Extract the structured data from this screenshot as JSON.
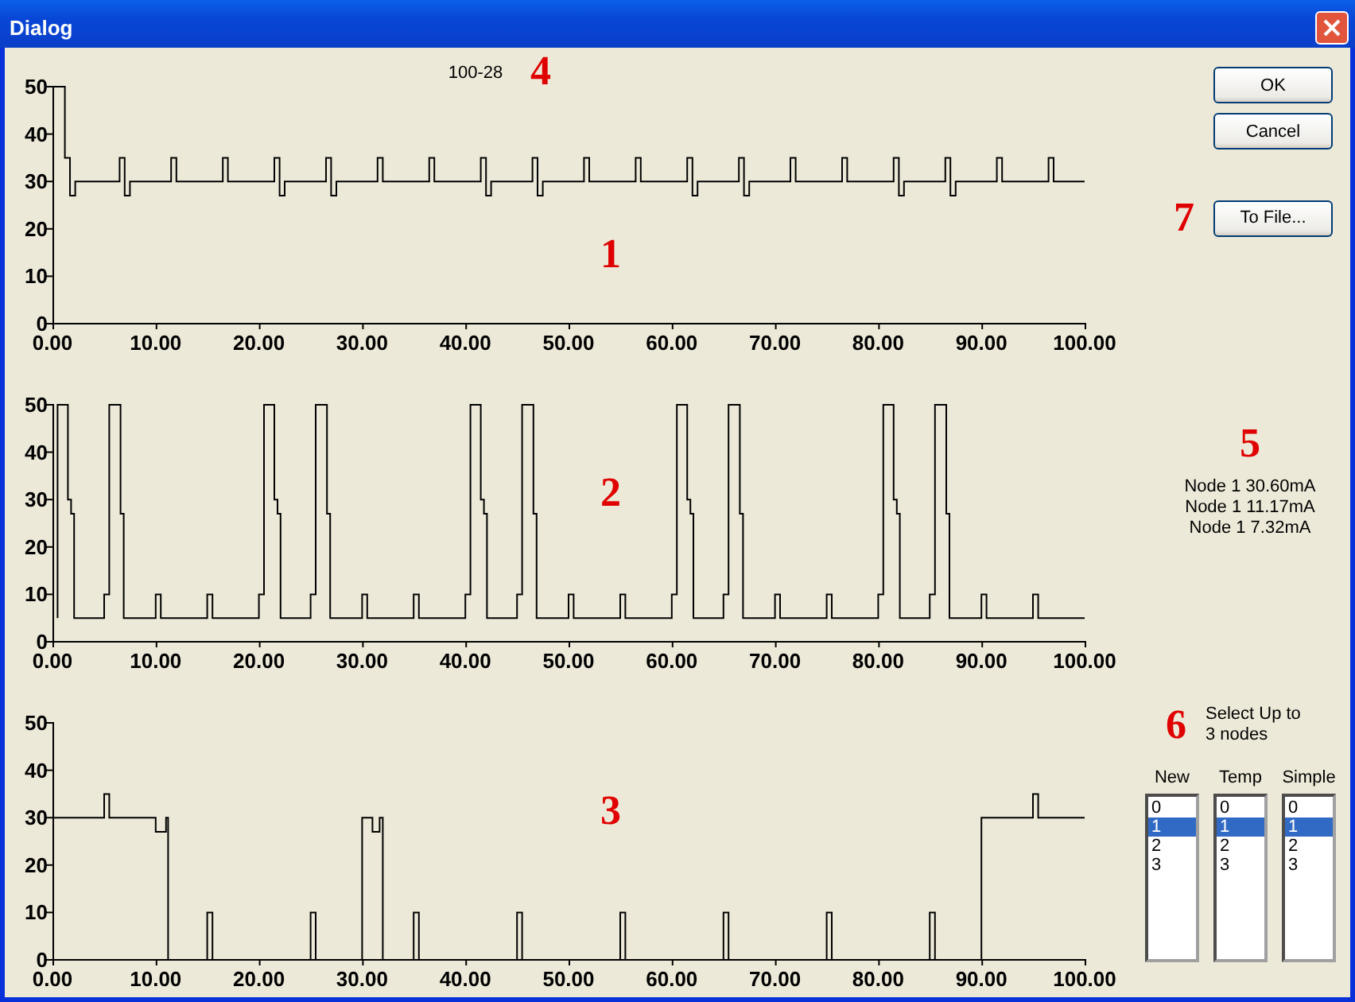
{
  "window": {
    "title": "Dialog"
  },
  "charts": [
    {
      "callout": "1",
      "title_callout": "4",
      "chart_data": {
        "type": "line",
        "title": "100-28",
        "xlim": [
          0,
          100
        ],
        "ylim": [
          0,
          50
        ],
        "xticks": [
          {
            "value": 0,
            "label": "0.00"
          },
          {
            "value": 10,
            "label": "10.00"
          },
          {
            "value": 20,
            "label": "20.00"
          },
          {
            "value": 30,
            "label": "30.00"
          },
          {
            "value": 40,
            "label": "40.00"
          },
          {
            "value": 50,
            "label": "50.00"
          },
          {
            "value": 60,
            "label": "60.00"
          },
          {
            "value": 70,
            "label": "70.00"
          },
          {
            "value": 80,
            "label": "80.00"
          },
          {
            "value": 90,
            "label": "90.00"
          },
          {
            "value": 100,
            "label": "100.00"
          }
        ],
        "yticks": [
          0,
          10,
          20,
          30,
          40,
          50
        ],
        "x": [
          0,
          1.2,
          1.2,
          1.7,
          1.7,
          2.2,
          2.2,
          6.5,
          6.5,
          7,
          7,
          7.5,
          7.5,
          11.5,
          11.5,
          12,
          12,
          16.5,
          16.5,
          17,
          17,
          21.5,
          21.5,
          22,
          22,
          22.5,
          22.5,
          26.5,
          26.5,
          27,
          27,
          27.5,
          27.5,
          31.5,
          31.5,
          32,
          32,
          36.5,
          36.5,
          37,
          37,
          41.5,
          41.5,
          42,
          42,
          42.5,
          42.5,
          46.5,
          46.5,
          47,
          47,
          47.5,
          47.5,
          51.5,
          51.5,
          52,
          52,
          56.5,
          56.5,
          57,
          57,
          61.5,
          61.5,
          62,
          62,
          62.5,
          62.5,
          66.5,
          66.5,
          67,
          67,
          67.5,
          67.5,
          71.5,
          71.5,
          72,
          72,
          76.5,
          76.5,
          77,
          77,
          81.5,
          81.5,
          82,
          82,
          82.5,
          82.5,
          86.5,
          86.5,
          87,
          87,
          87.5,
          87.5,
          91.5,
          91.5,
          92,
          92,
          96.5,
          96.5,
          97,
          97,
          100
        ],
        "series": [
          {
            "color": "#000000",
            "values": [
              50,
              50,
              35,
              35,
              27,
              27,
              30,
              30,
              35,
              35,
              27,
              27,
              30,
              30,
              35,
              35,
              30,
              30,
              35,
              35,
              30,
              30,
              35,
              35,
              27,
              27,
              30,
              30,
              35,
              35,
              27,
              27,
              30,
              30,
              35,
              35,
              30,
              30,
              35,
              35,
              30,
              30,
              35,
              35,
              27,
              27,
              30,
              30,
              35,
              35,
              27,
              27,
              30,
              30,
              35,
              35,
              30,
              30,
              35,
              35,
              30,
              30,
              35,
              35,
              27,
              27,
              30,
              30,
              35,
              35,
              27,
              27,
              30,
              30,
              35,
              35,
              30,
              30,
              35,
              35,
              30,
              30,
              35,
              35,
              27,
              27,
              30,
              30,
              35,
              35,
              27,
              27,
              30,
              30,
              35,
              35,
              30,
              30,
              35,
              35,
              30,
              30
            ]
          }
        ]
      }
    },
    {
      "callout": "2",
      "chart_data": {
        "type": "line",
        "xlim": [
          0,
          100
        ],
        "ylim": [
          0,
          50
        ],
        "xticks": [
          {
            "value": 0,
            "label": "0.00"
          },
          {
            "value": 10,
            "label": "10.00"
          },
          {
            "value": 20,
            "label": "20.00"
          },
          {
            "value": 30,
            "label": "30.00"
          },
          {
            "value": 40,
            "label": "40.00"
          },
          {
            "value": 50,
            "label": "50.00"
          },
          {
            "value": 60,
            "label": "60.00"
          },
          {
            "value": 70,
            "label": "70.00"
          },
          {
            "value": 80,
            "label": "80.00"
          },
          {
            "value": 90,
            "label": "90.00"
          },
          {
            "value": 100,
            "label": "100.00"
          }
        ],
        "yticks": [
          0,
          10,
          20,
          30,
          40,
          50
        ],
        "x": [
          0.5,
          0.5,
          1.5,
          1.5,
          1.8,
          1.8,
          2.1,
          2.1,
          5,
          5,
          5.5,
          5.5,
          6.6,
          6.6,
          6.9,
          6.9,
          10,
          10,
          10.5,
          10.5,
          15,
          15,
          15.5,
          15.5,
          20,
          20,
          20.5,
          20.5,
          21.5,
          21.5,
          21.8,
          21.8,
          22.1,
          22.1,
          25,
          25,
          25.5,
          25.5,
          26.6,
          26.6,
          26.9,
          26.9,
          30,
          30,
          30.5,
          30.5,
          35,
          35,
          35.5,
          35.5,
          40,
          40,
          40.5,
          40.5,
          41.5,
          41.5,
          41.8,
          41.8,
          42.1,
          42.1,
          45,
          45,
          45.5,
          45.5,
          46.6,
          46.6,
          46.9,
          46.9,
          50,
          50,
          50.5,
          50.5,
          55,
          55,
          55.5,
          55.5,
          60,
          60,
          60.5,
          60.5,
          61.5,
          61.5,
          61.8,
          61.8,
          62.1,
          62.1,
          65,
          65,
          65.5,
          65.5,
          66.6,
          66.6,
          66.9,
          66.9,
          70,
          70,
          70.5,
          70.5,
          75,
          75,
          75.5,
          75.5,
          80,
          80,
          80.5,
          80.5,
          81.5,
          81.5,
          81.8,
          81.8,
          82.1,
          82.1,
          85,
          85,
          85.5,
          85.5,
          86.6,
          86.6,
          86.9,
          86.9,
          90,
          90,
          90.5,
          90.5,
          95,
          95,
          95.5,
          95.5,
          100
        ],
        "series": [
          {
            "color": "#000000",
            "values": [
              5,
              50,
              50,
              30,
              30,
              27,
              27,
              5,
              5,
              10,
              10,
              50,
              50,
              27,
              27,
              5,
              5,
              10,
              10,
              5,
              5,
              10,
              10,
              5,
              5,
              10,
              10,
              50,
              50,
              30,
              30,
              27,
              27,
              5,
              5,
              10,
              10,
              50,
              50,
              27,
              27,
              5,
              5,
              10,
              10,
              5,
              5,
              10,
              10,
              5,
              5,
              10,
              10,
              50,
              50,
              30,
              30,
              27,
              27,
              5,
              5,
              10,
              10,
              50,
              50,
              27,
              27,
              5,
              5,
              10,
              10,
              5,
              5,
              10,
              10,
              5,
              5,
              10,
              10,
              50,
              50,
              30,
              30,
              27,
              27,
              5,
              5,
              10,
              10,
              50,
              50,
              27,
              27,
              5,
              5,
              10,
              10,
              5,
              5,
              10,
              10,
              5,
              5,
              10,
              10,
              50,
              50,
              30,
              30,
              27,
              27,
              5,
              5,
              10,
              10,
              50,
              50,
              27,
              27,
              5,
              5,
              10,
              10,
              5,
              5,
              10,
              10,
              5,
              5
            ]
          }
        ]
      }
    },
    {
      "callout": "3",
      "chart_data": {
        "type": "line",
        "xlim": [
          0,
          100
        ],
        "ylim": [
          0,
          50
        ],
        "xticks": [
          {
            "value": 0,
            "label": "0.00"
          },
          {
            "value": 10,
            "label": "10.00"
          },
          {
            "value": 20,
            "label": "20.00"
          },
          {
            "value": 30,
            "label": "30.00"
          },
          {
            "value": 40,
            "label": "40.00"
          },
          {
            "value": 50,
            "label": "50.00"
          },
          {
            "value": 60,
            "label": "60.00"
          },
          {
            "value": 70,
            "label": "70.00"
          },
          {
            "value": 80,
            "label": "80.00"
          },
          {
            "value": 90,
            "label": "90.00"
          },
          {
            "value": 100,
            "label": "100.00"
          }
        ],
        "yticks": [
          0,
          10,
          20,
          30,
          40,
          50
        ],
        "x": [
          0,
          5,
          5,
          5.5,
          5.5,
          10,
          10,
          11,
          11,
          11.2,
          11.2,
          15,
          15,
          15.5,
          15.5,
          25,
          25,
          25.5,
          25.5,
          30,
          30,
          31,
          31,
          31.7,
          31.7,
          32,
          32,
          35,
          35,
          35.5,
          35.5,
          45,
          45,
          45.5,
          45.5,
          55,
          55,
          55.5,
          55.5,
          65,
          65,
          65.5,
          65.5,
          75,
          75,
          75.5,
          75.5,
          85,
          85,
          85.5,
          85.5,
          90,
          90,
          95,
          95,
          95.5,
          95.5,
          100
        ],
        "series": [
          {
            "color": "#000000",
            "values": [
              30,
              30,
              35,
              35,
              30,
              30,
              27,
              27,
              30,
              30,
              0,
              0,
              10,
              10,
              0,
              0,
              10,
              10,
              0,
              0,
              30,
              30,
              27,
              27,
              30,
              30,
              0,
              0,
              10,
              10,
              0,
              0,
              10,
              10,
              0,
              0,
              10,
              10,
              0,
              0,
              10,
              10,
              0,
              0,
              10,
              10,
              0,
              0,
              10,
              10,
              0,
              0,
              30,
              30,
              35,
              35,
              30,
              30
            ]
          }
        ]
      }
    }
  ],
  "buttons": [
    {
      "label": "OK"
    },
    {
      "label": "Cancel"
    }
  ],
  "to_file": {
    "label": "To File...",
    "callout": "7"
  },
  "readings": {
    "callout": "5",
    "lines": [
      "Node 1 30.60mA",
      "Node 1 11.17mA",
      "Node 1 7.32mA"
    ]
  },
  "node_select": {
    "callout": "6",
    "instructions": "Select Up to 3 nodes",
    "lists": [
      {
        "header": "New",
        "items": [
          {
            "label": "0",
            "selected": false
          },
          {
            "label": "1",
            "selected": true
          },
          {
            "label": "2",
            "selected": false
          },
          {
            "label": "3",
            "selected": false
          }
        ]
      },
      {
        "header": "Temp",
        "items": [
          {
            "label": "0",
            "selected": false
          },
          {
            "label": "1",
            "selected": true
          },
          {
            "label": "2",
            "selected": false
          },
          {
            "label": "3",
            "selected": false
          }
        ]
      },
      {
        "header": "Simple",
        "items": [
          {
            "label": "0",
            "selected": false
          },
          {
            "label": "1",
            "selected": true
          },
          {
            "label": "2",
            "selected": false
          },
          {
            "label": "3",
            "selected": false
          }
        ]
      }
    ]
  }
}
